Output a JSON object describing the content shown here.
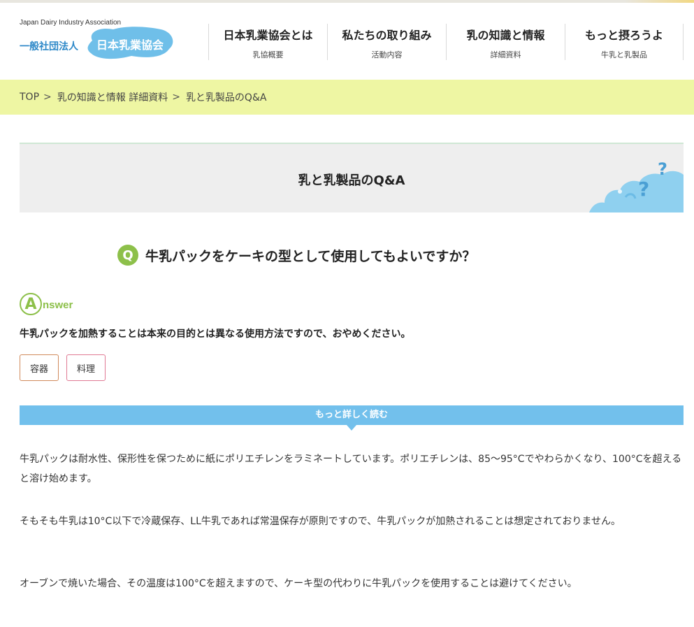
{
  "header": {
    "logo_en": "Japan Dairy Industry Association",
    "logo_prefix": "一般社団法人",
    "logo_name": "日本乳業協会",
    "logo_color": "#6fbfe9"
  },
  "nav": [
    {
      "main": "日本乳業協会とは",
      "sub": "乳協概要"
    },
    {
      "main": "私たちの取り組み",
      "sub": "活動内容"
    },
    {
      "main": "乳の知識と情報",
      "sub": "詳細資料"
    },
    {
      "main": "もっと摂ろうよ",
      "sub": "牛乳と乳製品"
    }
  ],
  "breadcrumb": {
    "top": "TOP",
    "sep": ">",
    "section": "乳の知識と情報 詳細資料",
    "current": "乳と乳製品のQ&A"
  },
  "page_title": "乳と乳製品のQ&A",
  "question": {
    "badge": "Q",
    "text": "牛乳パックをケーキの型として使用してもよいですか？"
  },
  "answer": {
    "badge": "A",
    "label": "nswer",
    "text": "牛乳パックを加熱することは本来の目的とは異なる使用方法ですので、おやめください。"
  },
  "tags": [
    "容器",
    "料理"
  ],
  "more_label": "もっと詳しく読む",
  "paragraphs": [
    "牛乳パックは耐水性、保形性を保つために紙にポリエチレンをラミネートしています。ポリエチレンは、85～95°Cでやわらかくなり、100°Cを超えると溶け始めます。",
    "そもそも牛乳は10°C以下で冷蔵保存、LL牛乳であれば常温保存が原則ですので、牛乳パックが加熱されることは想定されておりません。",
    "オーブンで焼いた場合、その温度は100°Cを超えますので、ケーキ型の代わりに牛乳パックを使用することは避けてください。"
  ],
  "colors": {
    "breadcrumb_bg": "#eef6a3",
    "accent_green": "#8dc04a",
    "more_bar": "#72c0ec",
    "title_bg": "#eeeeee"
  }
}
